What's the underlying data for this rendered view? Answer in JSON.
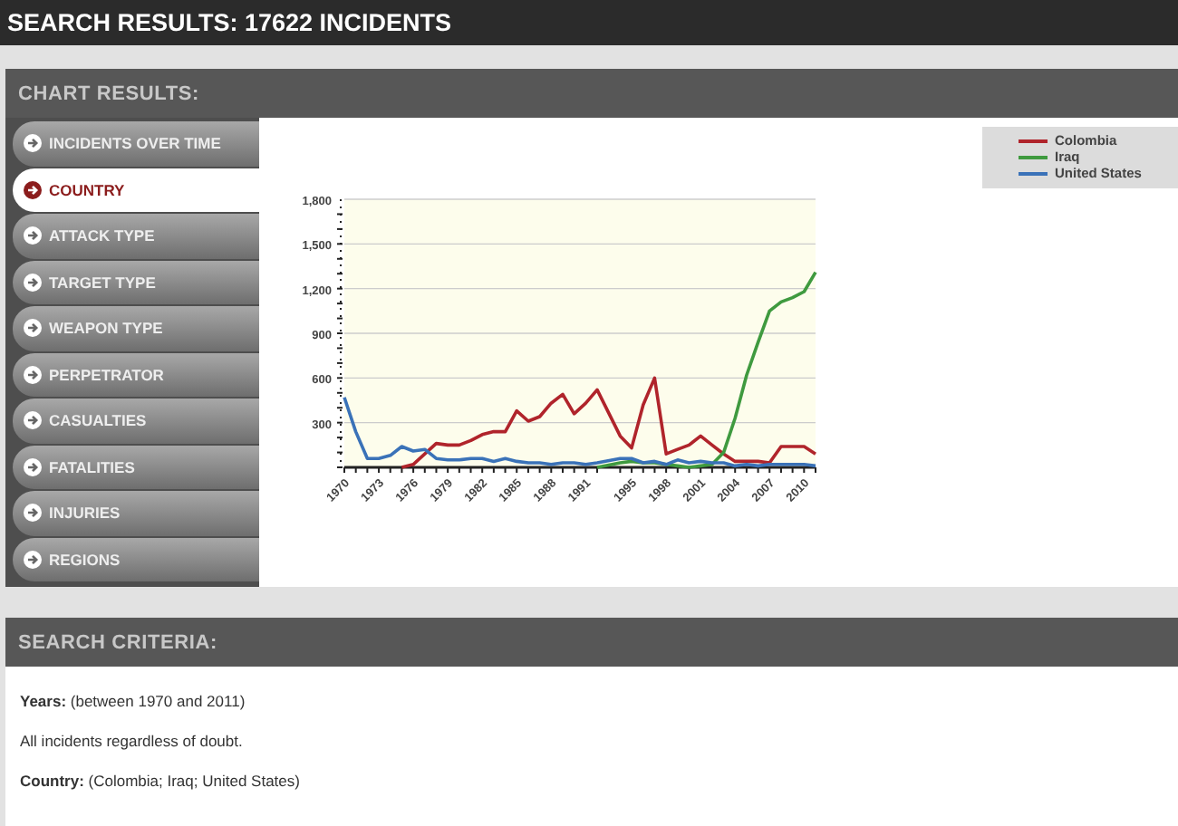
{
  "page_title": "SEARCH RESULTS: 17622 INCIDENTS",
  "chart_results": {
    "title": "CHART RESULTS:",
    "menu": [
      {
        "label": "INCIDENTS OVER TIME",
        "selected": false
      },
      {
        "label": "COUNTRY",
        "selected": true
      },
      {
        "label": "ATTACK TYPE",
        "selected": false
      },
      {
        "label": "TARGET TYPE",
        "selected": false
      },
      {
        "label": "WEAPON TYPE",
        "selected": false
      },
      {
        "label": "PERPETRATOR",
        "selected": false
      },
      {
        "label": "CASUALTIES",
        "selected": false
      },
      {
        "label": "FATALITIES",
        "selected": false
      },
      {
        "label": "INJURIES",
        "selected": false
      },
      {
        "label": "REGIONS",
        "selected": false
      }
    ],
    "chart_data": {
      "type": "line",
      "x": [
        1970,
        1971,
        1972,
        1973,
        1974,
        1975,
        1976,
        1977,
        1978,
        1979,
        1980,
        1981,
        1982,
        1983,
        1984,
        1985,
        1986,
        1987,
        1988,
        1989,
        1990,
        1991,
        1992,
        1994,
        1995,
        1996,
        1997,
        1998,
        1999,
        2000,
        2001,
        2002,
        2003,
        2004,
        2005,
        2006,
        2007,
        2008,
        2009,
        2010,
        2011
      ],
      "xlim": [
        1970,
        2011
      ],
      "xticks": [
        1970,
        1973,
        1976,
        1979,
        1982,
        1985,
        1988,
        1991,
        1995,
        1998,
        2001,
        2004,
        2007,
        2010
      ],
      "ylim": [
        0,
        1800
      ],
      "grid": true,
      "yticks": [
        {
          "value": 300,
          "label": "300"
        },
        {
          "value": 600,
          "label": "600"
        },
        {
          "value": 900,
          "label": "900"
        },
        {
          "value": 1200,
          "label": "1,200"
        },
        {
          "value": 1500,
          "label": "1,500"
        },
        {
          "value": 1800,
          "label": "1,800"
        }
      ],
      "series": [
        {
          "name": "Colombia",
          "color": "#b0242b",
          "values": [
            null,
            null,
            null,
            null,
            null,
            0,
            20,
            90,
            160,
            150,
            150,
            180,
            220,
            240,
            240,
            380,
            310,
            340,
            430,
            490,
            360,
            430,
            520,
            210,
            130,
            420,
            600,
            90,
            120,
            150,
            210,
            150,
            90,
            40,
            40,
            40,
            30,
            140,
            140,
            140,
            90
          ]
        },
        {
          "name": "Iraq",
          "color": "#3f9a3f",
          "values": [
            null,
            null,
            null,
            null,
            null,
            null,
            null,
            null,
            null,
            null,
            null,
            null,
            null,
            null,
            null,
            null,
            null,
            null,
            null,
            null,
            null,
            null,
            0,
            30,
            40,
            30,
            30,
            20,
            10,
            0,
            10,
            20,
            100,
            330,
            620,
            840,
            1050,
            1110,
            1140,
            1180,
            1310
          ]
        },
        {
          "name": "United States",
          "color": "#3a72b8",
          "values": [
            470,
            240,
            60,
            60,
            80,
            140,
            110,
            120,
            60,
            50,
            50,
            60,
            60,
            40,
            60,
            40,
            30,
            30,
            20,
            30,
            30,
            20,
            30,
            60,
            60,
            30,
            40,
            20,
            50,
            30,
            40,
            30,
            30,
            10,
            20,
            10,
            20,
            20,
            20,
            20,
            10
          ]
        }
      ]
    }
  },
  "search_criteria": {
    "title": "SEARCH CRITERIA:",
    "lines": [
      "**Years:** (between 1970 and 2011)",
      "All incidents regardless of doubt.",
      "**Country:** (Colombia; Iraq; United States)"
    ]
  }
}
